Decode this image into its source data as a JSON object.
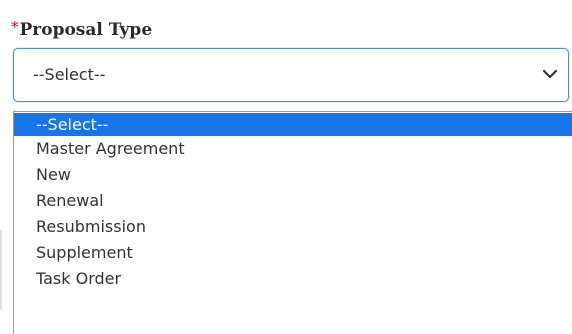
{
  "field": {
    "required_mark": "*",
    "label": "Proposal Type",
    "current_value": "--Select--"
  },
  "dropdown": {
    "options": [
      "--Select--",
      "Master Agreement",
      "New",
      "Renewal",
      "Resubmission",
      "Supplement",
      "Task Order"
    ],
    "selected_index": 0
  },
  "icons": {
    "select_arrow": "chevron-down-icon"
  },
  "colors": {
    "required": "#d0021b",
    "focus_border": "#4a8dd8",
    "highlight": "#1a73e8"
  }
}
